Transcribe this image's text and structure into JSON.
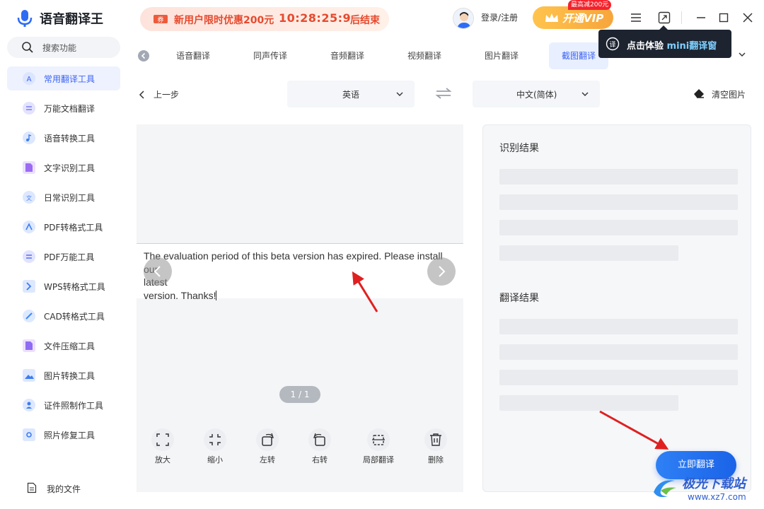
{
  "app": {
    "name": "语音翻译王",
    "login_label": "登录/注册",
    "vip_label": "开通VIP",
    "vip_badge": "最高减200元"
  },
  "promo": {
    "text": "新用户限时优惠200元",
    "countdown": "10:28:25:9",
    "suffix": "后结束"
  },
  "sidebar": {
    "search_label": "搜索功能",
    "items": [
      {
        "label": "常用翻译工具",
        "icon": "translate-icon",
        "color": "#3b63f5"
      },
      {
        "label": "万能文档翻译",
        "icon": "document-icon",
        "color": "#7b7df2"
      },
      {
        "label": "语音转换工具",
        "icon": "music-note-icon",
        "color": "#3d7cf0"
      },
      {
        "label": "文字识别工具",
        "icon": "text-scan-icon",
        "color": "#9b6cf2"
      },
      {
        "label": "日常识别工具",
        "icon": "lang-detect-icon",
        "color": "#4a7ff0"
      },
      {
        "label": "PDF转格式工具",
        "icon": "pdf-convert-icon",
        "color": "#3d7cf0"
      },
      {
        "label": "PDF万能工具",
        "icon": "pdf-tool-icon",
        "color": "#5a6ff0"
      },
      {
        "label": "WPS转格式工具",
        "icon": "wps-icon",
        "color": "#3d7cf0"
      },
      {
        "label": "CAD转格式工具",
        "icon": "cad-icon",
        "color": "#3d8cf0"
      },
      {
        "label": "文件压缩工具",
        "icon": "compress-icon",
        "color": "#8f6cf2"
      },
      {
        "label": "图片转换工具",
        "icon": "image-icon",
        "color": "#3d7cf0"
      },
      {
        "label": "证件照制作工具",
        "icon": "id-photo-icon",
        "color": "#3d7cf0"
      },
      {
        "label": "照片修复工具",
        "icon": "photo-repair-icon",
        "color": "#3d7cf0"
      }
    ],
    "my_files_label": "我的文件"
  },
  "tabs": [
    {
      "label": "语音翻译"
    },
    {
      "label": "同声传译"
    },
    {
      "label": "音频翻译"
    },
    {
      "label": "视频翻译"
    },
    {
      "label": "图片翻译"
    },
    {
      "label": "截图翻译",
      "active": true
    }
  ],
  "toolbar": {
    "back_label": "上一步",
    "source_lang": "英语",
    "target_lang": "中文(简体)",
    "clear_label": "清空图片"
  },
  "image_panel": {
    "text_line1": "The evaluation period of this beta version has expired. Please install our",
    "text_line2": "latest",
    "text_line3": "version. Thanks!",
    "page_indicator": "1 / 1",
    "tools": [
      {
        "label": "放大",
        "icon": "zoom-in-icon"
      },
      {
        "label": "缩小",
        "icon": "zoom-out-icon"
      },
      {
        "label": "左转",
        "icon": "rotate-left-icon"
      },
      {
        "label": "右转",
        "icon": "rotate-right-icon"
      },
      {
        "label": "局部翻译",
        "icon": "crop-icon"
      },
      {
        "label": "删除",
        "icon": "trash-icon"
      }
    ]
  },
  "result_panel": {
    "recognize_title": "识别结果",
    "translate_title": "翻译结果",
    "translate_button": "立即翻译"
  },
  "mini_tooltip": {
    "prefix": "点击体验",
    "highlight": "mini翻译窗"
  },
  "watermark": {
    "title": "极光下载站",
    "url": "www.xz7.com"
  },
  "colors": {
    "accent": "#3b63f5",
    "promo": "#e64a2e",
    "vip": "#f7a53b",
    "arrow": "#e02020"
  }
}
